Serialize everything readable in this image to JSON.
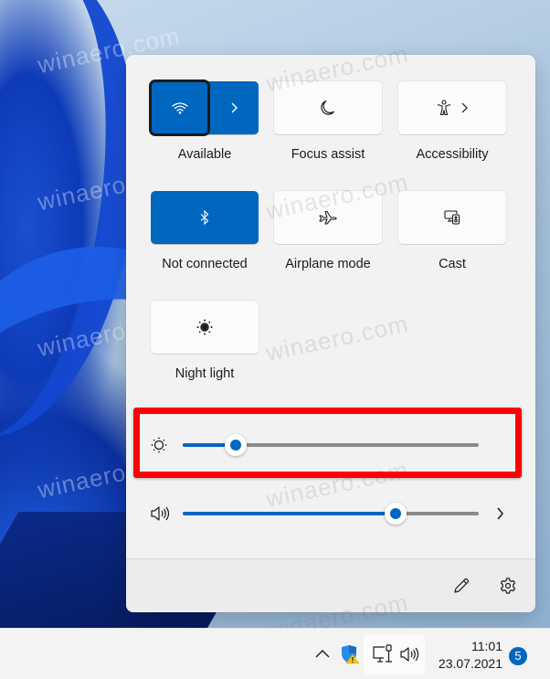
{
  "quick_settings": {
    "tiles": [
      {
        "id": "wifi",
        "label": "Available",
        "icon": "wifi-icon",
        "active": true,
        "has_chevron": true
      },
      {
        "id": "focus",
        "label": "Focus assist",
        "icon": "moon-icon",
        "active": false,
        "has_chevron": false
      },
      {
        "id": "accessibility",
        "label": "Accessibility",
        "icon": "accessibility-icon",
        "active": false,
        "has_chevron": true
      },
      {
        "id": "bluetooth",
        "label": "Not connected",
        "icon": "bluetooth-icon",
        "active": true,
        "has_chevron": false
      },
      {
        "id": "airplane",
        "label": "Airplane mode",
        "icon": "airplane-icon",
        "active": false,
        "has_chevron": false
      },
      {
        "id": "cast",
        "label": "Cast",
        "icon": "cast-icon",
        "active": false,
        "has_chevron": false
      },
      {
        "id": "nightlight",
        "label": "Night light",
        "icon": "night-light-icon",
        "active": false,
        "has_chevron": false
      }
    ],
    "sliders": {
      "brightness": {
        "icon": "brightness-icon",
        "value_percent": 18,
        "highlighted": true
      },
      "volume": {
        "icon": "speaker-icon",
        "value_percent": 72,
        "has_chevron": true
      }
    },
    "footer": {
      "edit_icon": "pencil-icon",
      "settings_icon": "gear-icon"
    }
  },
  "taskbar": {
    "tray": {
      "overflow_icon": "chevron-up-icon",
      "security_icon": "windows-security-warning-icon",
      "network_icon": "ethernet-icon",
      "volume_icon": "speaker-icon"
    },
    "clock": {
      "time": "11:01",
      "date": "23.07.2021"
    },
    "notification_count": "5"
  },
  "colors": {
    "accent": "#0067c0",
    "highlight": "#ff0000",
    "panel": "#f2f2f2"
  },
  "watermark": "winaero.com"
}
